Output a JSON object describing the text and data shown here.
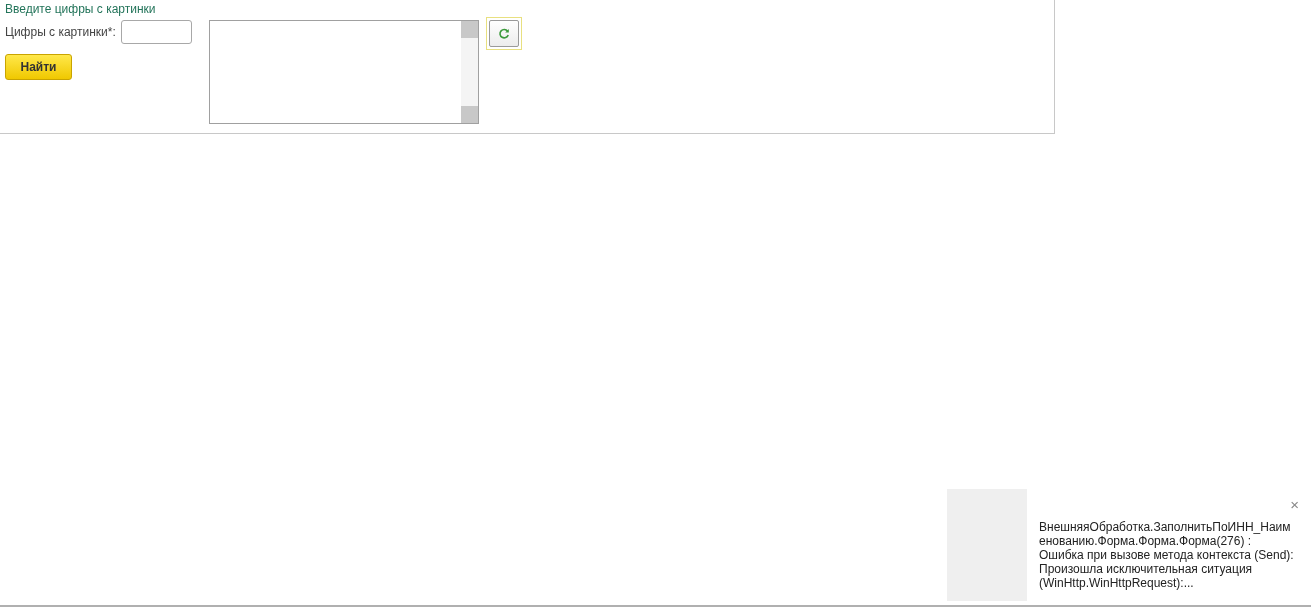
{
  "form": {
    "title": "Введите цифры с картинки",
    "code_field": {
      "label": "Цифры с картинки*:"
    },
    "find_button": "Найти"
  },
  "notification": {
    "close": "×",
    "message": "ВнешняяОбработка.ЗаполнитьПоИНН_Наименованию.Форма.Форма.Форма(276) : Ошибка при вызове метода контекста (Send): Произошла исключительная ситуация  (WinHttp.WinHttpRequest):..."
  }
}
